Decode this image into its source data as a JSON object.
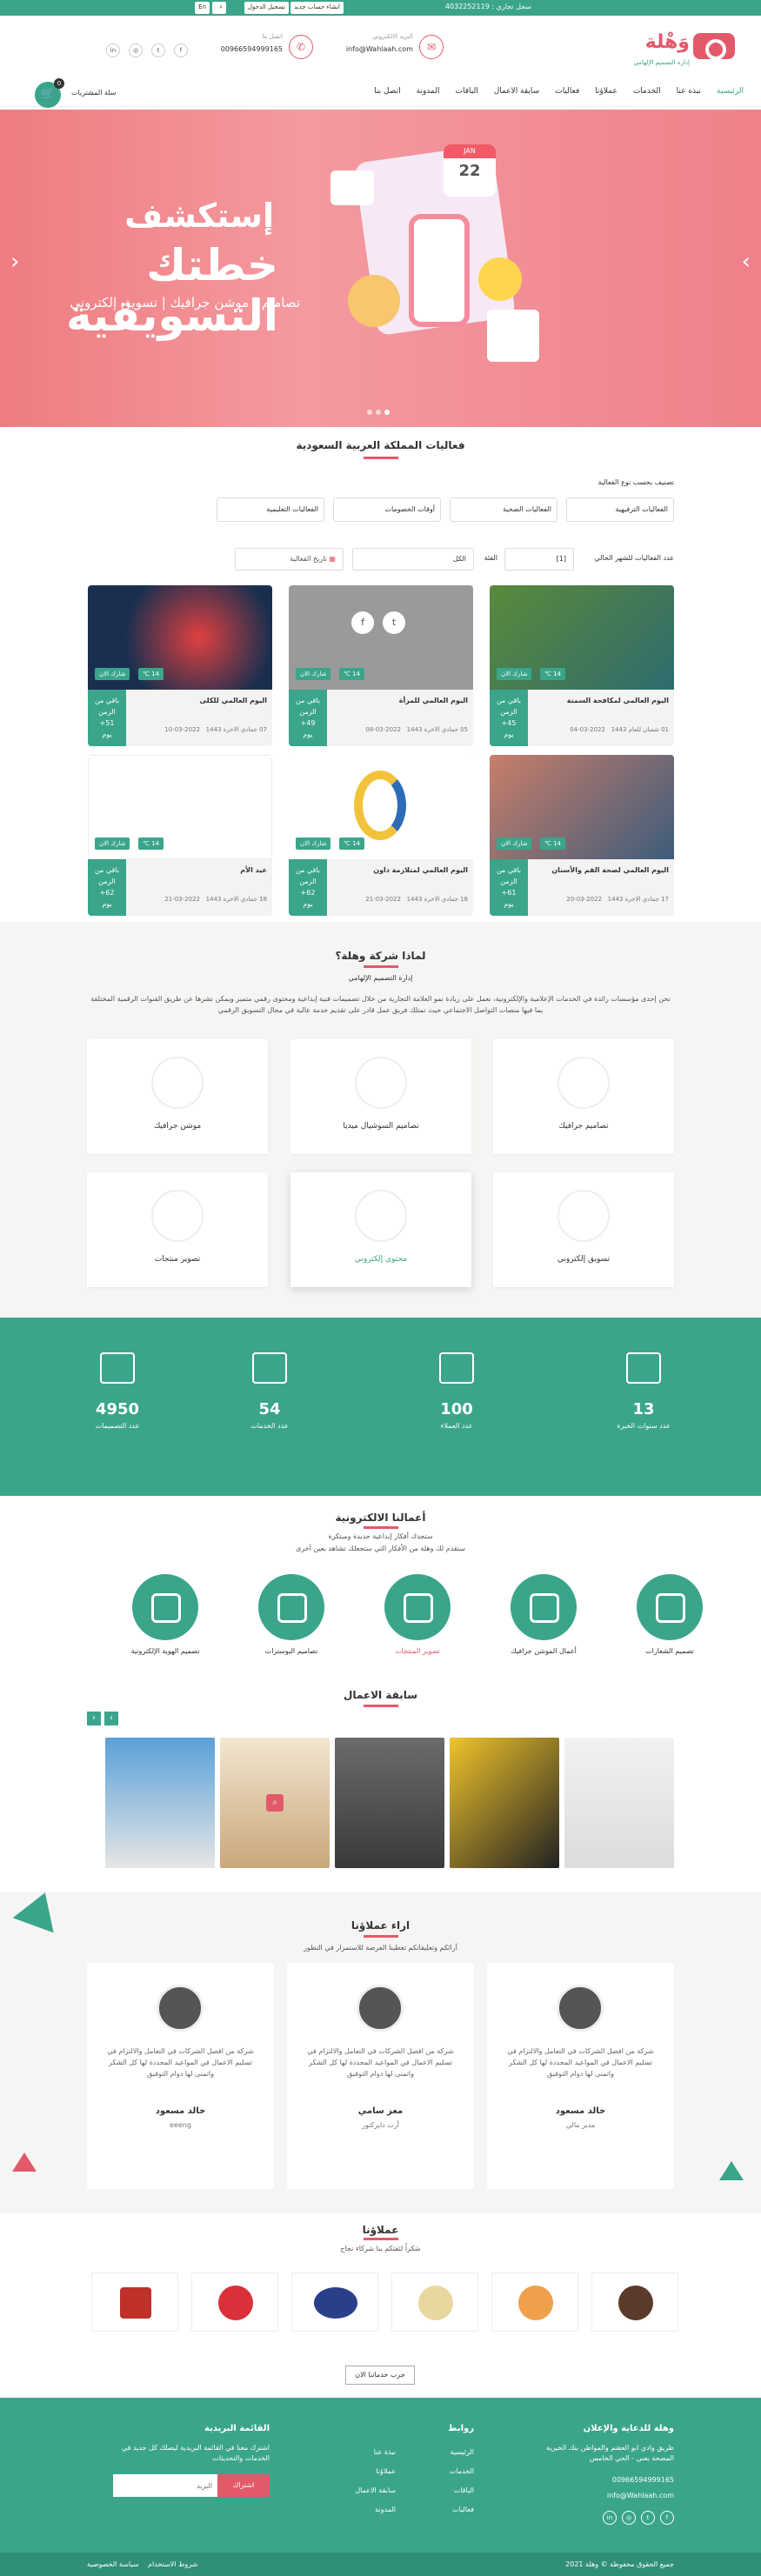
{
  "topbar": {
    "phone_label": "سجل تجاري : 4032252119",
    "create_account": "انشاء حساب جديد",
    "login": "تسجيل الدخول",
    "lang": "En"
  },
  "header": {
    "logo_text": "وَهْلة",
    "logo_sub": "إدارة التصميم الإلهامي",
    "email_label": "البريد الالكتروني",
    "email": "info@Wahlaah.com",
    "call_label": "اتصل بنا",
    "phone": "00966594999165",
    "cart_label": "سلة المشتريات",
    "cart_count": "0",
    "nav": [
      "الرئيسية",
      "نبذه عنا",
      "الخدمات",
      "عملاؤنا",
      "فعاليات",
      "سابقة الاعمال",
      "الباقات",
      "المدونة",
      "اتصل بنا"
    ]
  },
  "hero": {
    "line1": "إستكشف",
    "line2": "خطتك التسويقية",
    "line3": "تصاميم | موشن جرافيك | تسويق إلكتروني",
    "calendar_month": "JAN",
    "calendar_day": "22"
  },
  "events": {
    "title": "فعاليات المملكة العربية السعودية",
    "filter_label": "تصنيف بحسب نوع الفعالية",
    "filters": [
      "الفعاليات الترفيهية",
      "الفعاليات الصحية",
      "أوقات الخصومات",
      "الفعاليات التعليمية"
    ],
    "count_label": "عدد الفعاليات للشهر الحالي",
    "count_value": "[1]",
    "category_label": "الفئة",
    "category_value": "الكل",
    "date_label": "تاريخ الفعالية",
    "cards": [
      {
        "title": "اليوم العالمي لمكافحة السمنة",
        "remaining": "باقي من الزمن",
        "days": "45+",
        "unit": "يوم",
        "hijri": "01 شعبان للعام 1443",
        "greg": "2022-03-04",
        "badge1": "شارك الان",
        "badge2": "14 ℃"
      },
      {
        "title": "اليوم العالمي للمرأة",
        "remaining": "باقي من الزمن",
        "days": "49+",
        "unit": "يوم",
        "hijri": "05 جمادي الاخرة 1443",
        "greg": "2022-03-08",
        "badge1": "شارك الان",
        "badge2": "14 ℃"
      },
      {
        "title": "اليوم العالمي للكلى",
        "remaining": "باقي من الزمن",
        "days": "51+",
        "unit": "يوم",
        "hijri": "07 جمادي الاخرة 1443",
        "greg": "2022-03-10",
        "badge1": "شارك الان",
        "badge2": "14 ℃"
      },
      {
        "title": "اليوم العالمي لصحة الفم والأسنان",
        "remaining": "باقي من الزمن",
        "days": "61+",
        "unit": "يوم",
        "hijri": "17 جمادي الاخرة 1443",
        "greg": "2022-03-20",
        "badge1": "شارك الان",
        "badge2": "14 ℃"
      },
      {
        "title": "اليوم العالمي لمتلازمة داون",
        "remaining": "باقي من الزمن",
        "days": "62+",
        "unit": "يوم",
        "hijri": "18 جمادي الاخرة 1443",
        "greg": "2022-03-21",
        "badge1": "شارك الان",
        "badge2": "14 ℃"
      },
      {
        "title": "عيد الأم",
        "remaining": "باقي من الزمن",
        "days": "62+",
        "unit": "يوم",
        "hijri": "18 جمادي الاخرة 1443",
        "greg": "2022-03-21",
        "badge1": "شارك الان",
        "badge2": "14 ℃"
      }
    ]
  },
  "why": {
    "title": "لماذا شركة وهلة؟",
    "subtitle": "إدارة التصميم الإلهامي",
    "desc": "نحن إحدى مؤسسات رائدة في الخدمات الإعلامية والإلكترونية، نعمل على زيادة نمو العلامة التجارية من خلال تصميمات فنية إبداعية ومحتوى رقمي متميز ويمكن نشرها عن طريق القنوات الرقمية المختلفة بما فيها منصات التواصل الاجتماعي حيث نمتلك فريق عمل قادر على تقديم خدمة عالية في مجال التسويق الرقمي",
    "services": [
      "تصاميم جرافيك",
      "تصاميم السوشيال ميديا",
      "موشن جرافيك",
      "تسويق إلكتروني",
      "محتوى إلكتروني",
      "تصوير منتجات"
    ]
  },
  "stats": [
    {
      "num": "13",
      "label": "عدد سنوات الخبرة"
    },
    {
      "num": "100",
      "label": "عدد العملاء"
    },
    {
      "num": "54",
      "label": "عدد الخدمات"
    },
    {
      "num": "4950",
      "label": "عدد التصميمات"
    }
  ],
  "eservices": {
    "title": "أعمالنا الالكترونية",
    "sub1": "ستجدك أفكار إبداعية جديدة ومبتكرة",
    "sub2": "ستقدم لك وهلة من الأفكار التي ستجعلك تشاهد بعين أخرى",
    "items": [
      "تصميم الشعارات",
      "أعمال الموشن جرافيك",
      "تصوير المنتجات",
      "تصاميم البوسترات",
      "تصميم الهوية الإلكترونية"
    ]
  },
  "portfolio": {
    "title": "سابقة الاعمال"
  },
  "testimonials": {
    "title": "اراء عملاؤنا",
    "subtitle": "آرائكم وتعليقاتكم تعطينا الفرصة للاستمرار في التطور",
    "items": [
      {
        "text": "شركة من افضل الشركات في التعامل والالتزام في تسليم الاعمال في المواعيد المحددة لها كل الشكر واتمنى لها دوام التوفيق",
        "name": "خالد مسعود",
        "role": "مدير مالي"
      },
      {
        "text": "شركة من افضل الشركات في التعامل والالتزام في تسليم الاعمال في المواعيد المحددة لها كل الشكر واتمنى لها دوام التوفيق",
        "name": "معز سامي",
        "role": "أرت دايركتور"
      },
      {
        "text": "شركة من افضل الشركات في التعامل والالتزام في تسليم الاعمال في المواعيد المحددة لها كل الشكر واتمنى لها دوام التوفيق",
        "name": "خالد مسعود",
        "role": "eeeng"
      }
    ]
  },
  "clients": {
    "title": "عملاؤنا",
    "subtitle": "شكراً لثقتكم بنا شركاء نجاح",
    "button": "جرب خدماتنا الان"
  },
  "footer": {
    "about_title": "وهلة للدعاية والإعلان",
    "address": "طريق وادي ابو العشم والمواطن بنك الخيرية المصحة يعني - الحي الخامس",
    "phone": "00966594999165",
    "email": "info@Wahlaah.com",
    "links_title": "روابط",
    "links_col1": [
      "الرئيسية",
      "الخدمات",
      "الباقات",
      "فعاليات"
    ],
    "links_col2": [
      "نبذة عنا",
      "عملاؤنا",
      "سابقة الاعمال",
      "المدونة"
    ],
    "newsletter_title": "القائمة البريدية",
    "newsletter_desc": "اشترك معنا في القائمة البريدية ليصلك كل جديد في الخدمات والتحديثات",
    "newsletter_placeholder": "البريد",
    "subscribe": "اشتراك",
    "copyright": "جميع الحقوق محفوظة © وهلة 2021",
    "policy": "سياسة الخصوصية",
    "terms": "شروط الاستخدام"
  }
}
